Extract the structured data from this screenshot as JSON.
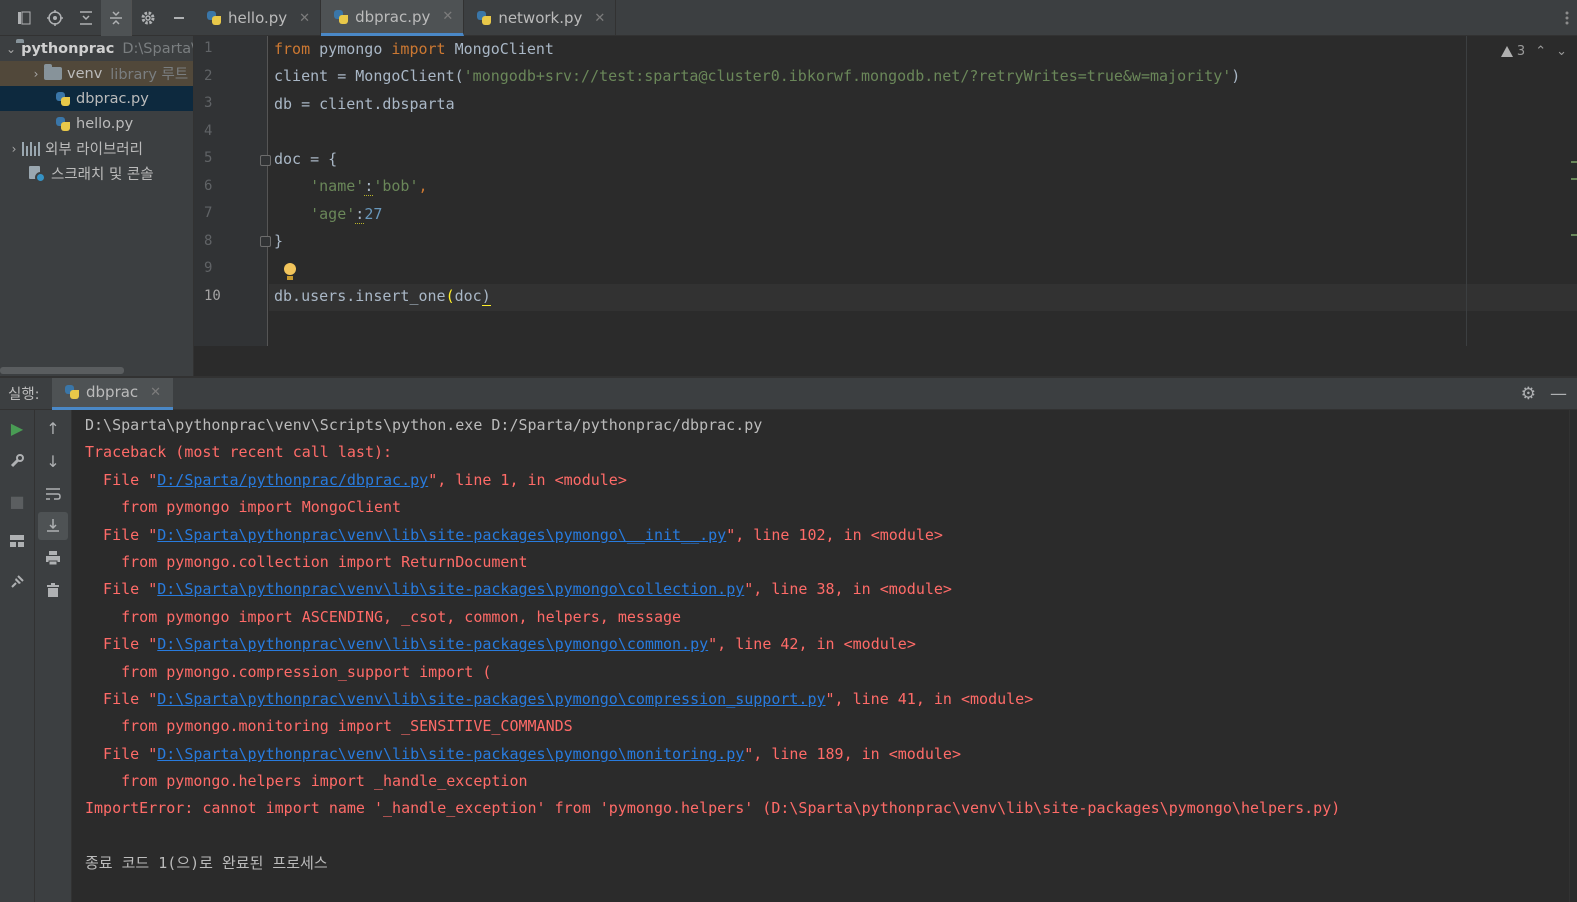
{
  "editor_tabs": [
    {
      "label": "hello.py",
      "active": false
    },
    {
      "label": "dbprac.py",
      "active": true
    },
    {
      "label": "network.py",
      "active": false
    }
  ],
  "project": {
    "root_name": "pythonprac",
    "root_path": "D:\\Sparta\\pythonprac",
    "venv_label": "venv",
    "venv_hint": "library 루트",
    "files": [
      "dbprac.py",
      "hello.py"
    ],
    "external_libs": "외부 라이브러리",
    "scratches": "스크래치 및 콘솔"
  },
  "editor": {
    "line_numbers": [
      "1",
      "2",
      "3",
      "4",
      "5",
      "6",
      "7",
      "8",
      "9",
      "10"
    ],
    "current_line": "10",
    "warning_count": "3",
    "code": {
      "l1_from": "from",
      "l1_mod": " pymongo ",
      "l1_import": "import",
      "l1_name": " MongoClient",
      "l2_pre": "client = MongoClient(",
      "l2_str": "'mongodb+srv://test:sparta@cluster0.ibkorwf.mongodb.net/?retryWrites=true&w=majority'",
      "l2_post": ")",
      "l3": "db = client.dbsparta",
      "l5": "doc = {",
      "l6_key": "'name'",
      "l6_colon": ":",
      "l6_val": "'bob'",
      "l6_comma": ",",
      "l7_key": "'age'",
      "l7_colon": ":",
      "l7_val": "27",
      "l8": "}",
      "l10_pre": "db.users.insert_one",
      "l10_open": "(",
      "l10_arg": "doc",
      "l10_close": ")"
    }
  },
  "run": {
    "label": "실행:",
    "tab": "dbprac"
  },
  "console": {
    "cmd": "D:\\Sparta\\pythonprac\\venv\\Scripts\\python.exe D:/Sparta/pythonprac/dbprac.py",
    "traceback": "Traceback (most recent call last):",
    "frames": [
      {
        "file_pre": "  File \"",
        "link": "D:/Sparta/pythonprac/dbprac.py",
        "file_post": "\", line 1, in <module>",
        "src": "    from pymongo import MongoClient"
      },
      {
        "file_pre": "  File \"",
        "link": "D:\\Sparta\\pythonprac\\venv\\lib\\site-packages\\pymongo\\__init__.py",
        "file_post": "\", line 102, in <module>",
        "src": "    from pymongo.collection import ReturnDocument"
      },
      {
        "file_pre": "  File \"",
        "link": "D:\\Sparta\\pythonprac\\venv\\lib\\site-packages\\pymongo\\collection.py",
        "file_post": "\", line 38, in <module>",
        "src": "    from pymongo import ASCENDING, _csot, common, helpers, message"
      },
      {
        "file_pre": "  File \"",
        "link": "D:\\Sparta\\pythonprac\\venv\\lib\\site-packages\\pymongo\\common.py",
        "file_post": "\", line 42, in <module>",
        "src": "    from pymongo.compression_support import ("
      },
      {
        "file_pre": "  File \"",
        "link": "D:\\Sparta\\pythonprac\\venv\\lib\\site-packages\\pymongo\\compression_support.py",
        "file_post": "\", line 41, in <module>",
        "src": "    from pymongo.monitoring import _SENSITIVE_COMMANDS"
      },
      {
        "file_pre": "  File \"",
        "link": "D:\\Sparta\\pythonprac\\venv\\lib\\site-packages\\pymongo\\monitoring.py",
        "file_post": "\", line 189, in <module>",
        "src": "    from pymongo.helpers import _handle_exception"
      }
    ],
    "error": "ImportError: cannot import name '_handle_exception' from 'pymongo.helpers' (D:\\Sparta\\pythonprac\\venv\\lib\\site-packages\\pymongo\\helpers.py)",
    "exit": "종료 코드 1(으)로 완료된 프로세스"
  },
  "colors": {
    "keyword": "#cc7832",
    "string": "#6a8759",
    "number": "#6897bb",
    "error": "#ff6b68",
    "link": "#287bde"
  }
}
